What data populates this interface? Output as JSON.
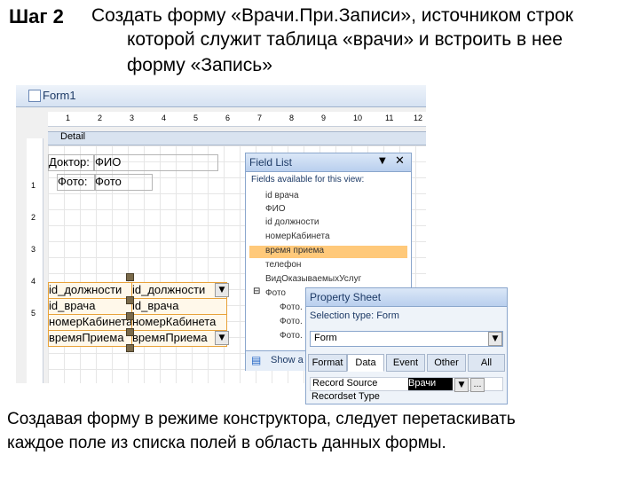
{
  "slide": {
    "step": "Шаг 2",
    "heading_line1": "Создать форму «Врачи.При.Записи», источником строк",
    "heading_line2": "которой служит таблица «врачи» и встроить в нее",
    "heading_line3": "форму «Запись»",
    "caption_line1": "Создавая форму в режиме конструктора, следует перетаскивать",
    "caption_line2": "каждое поле из списка полей в область данных формы."
  },
  "designer": {
    "tab_label": "Form1",
    "ruler_marks": [
      "1",
      "2",
      "3",
      "4",
      "5",
      "6",
      "7",
      "8",
      "9",
      "10",
      "11",
      "12"
    ],
    "vertical_marks": [
      "1",
      "2",
      "3",
      "4",
      "5"
    ],
    "section_label": "Detail",
    "controls": [
      {
        "label": "Доктор:",
        "value": "ФИО"
      },
      {
        "label": "Фото:",
        "value": "Фото"
      }
    ],
    "selected_controls": [
      {
        "label": "id_должности",
        "value": "id_должности"
      },
      {
        "label": "id_врача",
        "value": "id_врача"
      },
      {
        "label": "номерКабинета",
        "value": "номерКабинета"
      },
      {
        "label": "времяПриема",
        "value": "времяПриема"
      }
    ]
  },
  "field_list": {
    "title": "Field List",
    "heading": "Fields available for this view:",
    "fields": [
      "id врача",
      "ФИО",
      "id должности",
      "номерКабинета",
      "время приема",
      "телефон",
      "ВидОказываемыхУслуг",
      "Фото"
    ],
    "subfields": [
      "Фото.",
      "Фото.",
      "Фото."
    ],
    "highlighted_index": 4,
    "footer": "Show a"
  },
  "property_sheet": {
    "title": "Property Sheet",
    "selection_type": "Selection type: Form",
    "object": "Form",
    "tabs": [
      "Format",
      "Data",
      "Event",
      "Other",
      "All"
    ],
    "active_tab": 1,
    "record_source_label": "Record Source",
    "record_source_value": "Врачи",
    "next_row_label": "Recordset Type"
  }
}
